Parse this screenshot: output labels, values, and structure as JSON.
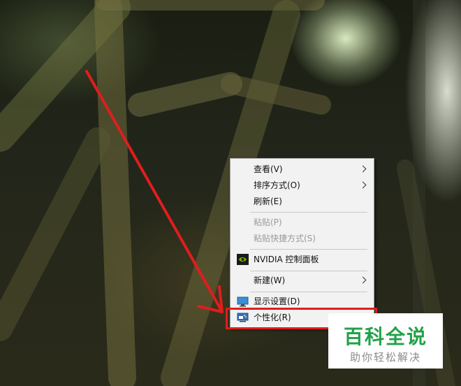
{
  "context_menu": {
    "items": [
      {
        "label": "查看(V)",
        "has_submenu": true,
        "enabled": true
      },
      {
        "label": "排序方式(O)",
        "has_submenu": true,
        "enabled": true
      },
      {
        "label": "刷新(E)",
        "has_submenu": false,
        "enabled": true
      },
      {
        "label": "粘贴(P)",
        "has_submenu": false,
        "enabled": false
      },
      {
        "label": "粘贴快捷方式(S)",
        "has_submenu": false,
        "enabled": false
      },
      {
        "label": "NVIDIA 控制面板",
        "has_submenu": false,
        "enabled": true,
        "icon": "nvidia-icon"
      },
      {
        "label": "新建(W)",
        "has_submenu": true,
        "enabled": true
      },
      {
        "label": "显示设置(D)",
        "has_submenu": false,
        "enabled": true,
        "icon": "display-icon"
      },
      {
        "label": "个性化(R)",
        "has_submenu": false,
        "enabled": true,
        "icon": "personalize-icon"
      }
    ]
  },
  "annotation": {
    "color": "#e01d1d",
    "target_item": "个性化(R)"
  },
  "watermark": {
    "title": "百科全说",
    "subtitle": "助你轻松解决",
    "title_color": "#22a14a"
  }
}
